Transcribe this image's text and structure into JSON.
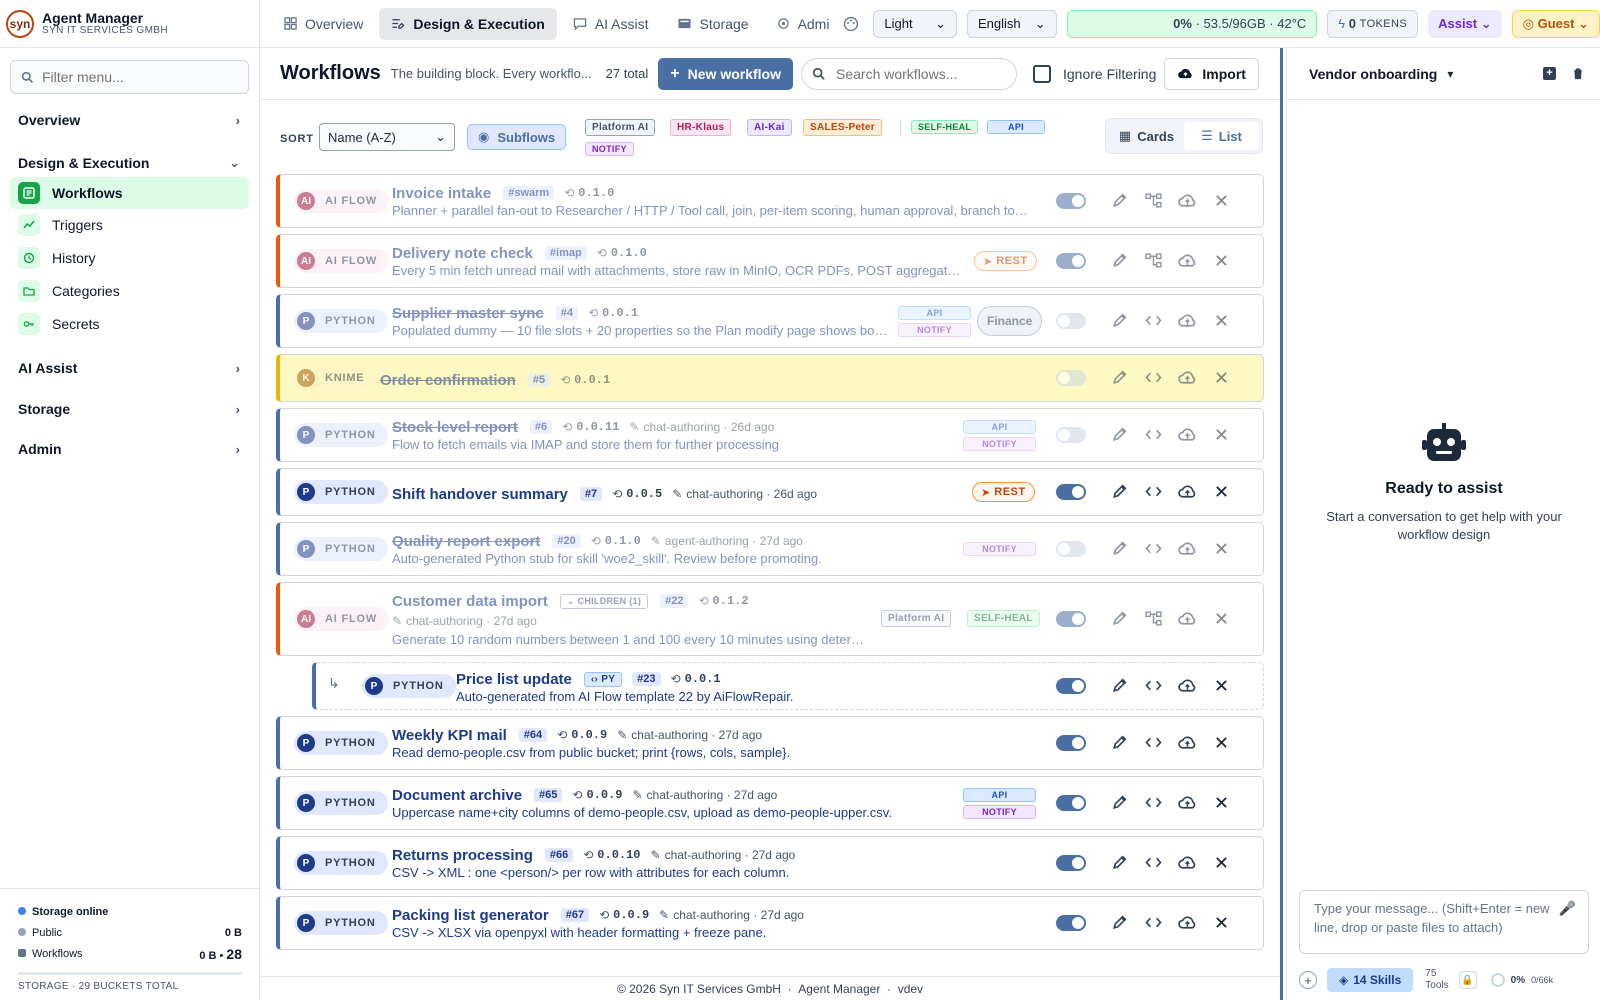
{
  "brand": {
    "title": "Agent Manager",
    "subtitle": "SYN IT SERVICES GMBH",
    "logo": "syn"
  },
  "sidebar": {
    "filter_placeholder": "Filter menu...",
    "sections": {
      "overview": "Overview",
      "design": "Design & Execution",
      "ai": "AI Assist",
      "storage": "Storage",
      "admin": "Admin"
    },
    "items": [
      "Workflows",
      "Triggers",
      "History",
      "Categories",
      "Secrets"
    ],
    "storage": {
      "status": "Storage online",
      "public_label": "Public",
      "public_size": "0 B",
      "workflows_label": "Workflows",
      "workflows_size": "0 B",
      "workflows_count": "28",
      "total": "STORAGE · 29 BUCKETS TOTAL"
    }
  },
  "topbar": {
    "tabs": [
      "Overview",
      "Design & Execution",
      "AI Assist",
      "Storage",
      "Admi"
    ],
    "theme": "Light",
    "language": "English",
    "usage": {
      "pct": "0%",
      "mem": "53.5/96GB",
      "temp": "42°C"
    },
    "tokens": "0",
    "tokens_label": "TOKENS",
    "assist": "Assist",
    "user": "Guest"
  },
  "main": {
    "title": "Workflows",
    "description": "The building block. Every workflo...",
    "total": "27 total",
    "new_button": "New workflow",
    "search_placeholder": "Search workflows...",
    "ignore_label": "Ignore Filtering",
    "import_button": "Import",
    "sort_label": "SORT",
    "sort_value": "Name (A-Z)",
    "subflows_label": "Subflows",
    "filter_tags": [
      "Platform AI",
      "HR-Klaus",
      "AI-Kai",
      "SALES-Peter",
      "SELF-HEAL",
      "API",
      "NOTIFY"
    ],
    "view": {
      "cards": "Cards",
      "list": "List"
    }
  },
  "rows": [
    {
      "type": "AI FLOW",
      "letter": "AI",
      "title": "Invoice intake",
      "num": "#swarm",
      "ver": "0.1.0",
      "meta": "",
      "desc": "Planner + parallel fan-out to Researcher / HTTP / Tool call, join, per-item scoring, human approval, branch to Su..."
    },
    {
      "type": "AI FLOW",
      "letter": "AI",
      "title": "Delivery note check",
      "num": "#imap",
      "ver": "0.1.0",
      "meta": "",
      "desc": "Every 5 min fetch unread mail with attachments, store raw in MinIO, OCR PDFs, POST aggregate to ...",
      "rest": "REST"
    },
    {
      "type": "PYTHON",
      "letter": "P",
      "title": "Supplier master sync",
      "num": "#4",
      "ver": "0.0.1",
      "meta": "",
      "desc": "Populated dummy — 10 file slots + 20 properties so the Plan modify page shows both ...",
      "tags": [
        "API",
        "NOTIFY"
      ],
      "category": "Finance"
    },
    {
      "type": "KNIME",
      "letter": "K",
      "title": "Order confirmation",
      "num": "#5",
      "ver": "0.0.1",
      "meta": "",
      "desc": ""
    },
    {
      "type": "PYTHON",
      "letter": "P",
      "title": "Stock level report",
      "num": "#6",
      "ver": "0.0.11",
      "meta": "chat-authoring · 26d ago",
      "desc": "Flow to fetch emails via IMAP and store them for further processing",
      "tags": [
        "API",
        "NOTIFY"
      ]
    },
    {
      "type": "PYTHON",
      "letter": "P",
      "title": "Shift handover summary",
      "num": "#7",
      "ver": "0.0.5",
      "meta": "chat-authoring · 26d ago",
      "desc": "",
      "rest": "REST"
    },
    {
      "type": "PYTHON",
      "letter": "P",
      "title": "Quality report export",
      "num": "#20",
      "ver": "0.1.0",
      "meta": "agent-authoring · 27d ago",
      "desc": "Auto-generated Python stub for skill 'woe2_skill'. Review before promoting.",
      "tags": [
        "NOTIFY"
      ]
    },
    {
      "type": "AI FLOW",
      "letter": "AI",
      "title": "Customer data import",
      "children": "CHILDREN (1)",
      "num": "#22",
      "ver": "0.1.2",
      "meta": "chat-authoring · 27d ago",
      "desc": "Generate 10 random numbers between 1 and 100 every 10 minutes using determini...",
      "tags": [
        "Platform AI",
        "SELF-HEAL"
      ]
    },
    {
      "type": "PYTHON",
      "letter": "P",
      "title": "Price list update",
      "py": "PY",
      "num": "#23",
      "ver": "0.0.1",
      "meta": "",
      "desc": "Auto-generated from AI Flow template 22 by AiFlowRepair."
    },
    {
      "type": "PYTHON",
      "letter": "P",
      "title": "Weekly KPI mail",
      "num": "#64",
      "ver": "0.0.9",
      "meta": "chat-authoring · 27d ago",
      "desc": "Read demo-people.csv from public bucket; print {rows, cols, sample}."
    },
    {
      "type": "PYTHON",
      "letter": "P",
      "title": "Document archive",
      "num": "#65",
      "ver": "0.0.9",
      "meta": "chat-authoring · 27d ago",
      "desc": "Uppercase name+city columns of demo-people.csv, upload as demo-people-upper.csv.",
      "tags": [
        "API",
        "NOTIFY"
      ]
    },
    {
      "type": "PYTHON",
      "letter": "P",
      "title": "Returns processing",
      "num": "#66",
      "ver": "0.0.10",
      "meta": "chat-authoring · 27d ago",
      "desc": "CSV -> XML : one <person/> per row with attributes for each column."
    },
    {
      "type": "PYTHON",
      "letter": "P",
      "title": "Packing list generator",
      "num": "#67",
      "ver": "0.0.9",
      "meta": "chat-authoring · 27d ago",
      "desc": "CSV -> XLSX via openpyxl with header formatting + freeze pane."
    }
  ],
  "assistant": {
    "workflow": "Vendor onboarding",
    "ready_title": "Ready to assist",
    "ready_text": "Start a conversation to get help with your workflow design",
    "input_placeholder": "Type your message... (Shift+Enter = new line, drop or paste files to attach)",
    "skills": "14 Skills",
    "tools_count": "75",
    "tools_label": "Tools",
    "ctx_pct": "0%",
    "ctx_total": "0/66k"
  },
  "footer": {
    "copyright": "© 2026 Syn IT Services GmbH",
    "app": "Agent Manager",
    "env": "vdev"
  }
}
